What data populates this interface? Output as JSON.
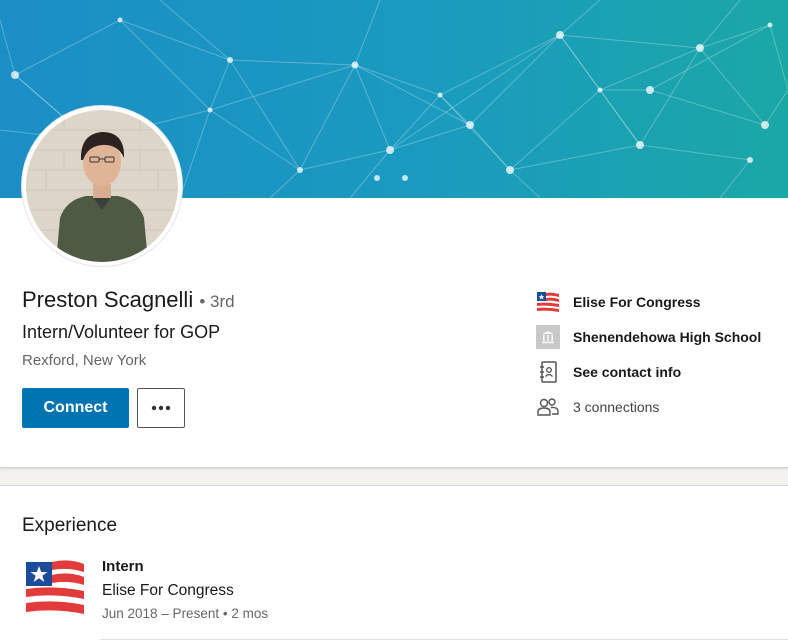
{
  "profile": {
    "name": "Preston Scagnelli",
    "degree": "• 3rd",
    "headline": "Intern/Volunteer for GOP",
    "location": "Rexford, New York"
  },
  "actions": {
    "connect_label": "Connect",
    "more_label": "···"
  },
  "sidebar": {
    "items": [
      {
        "label": "Elise For Congress",
        "icon": "flag-logo-icon"
      },
      {
        "label": "Shenendehowa High School",
        "icon": "school-icon"
      },
      {
        "label": "See contact info",
        "icon": "contact-book-icon"
      },
      {
        "label": "3 connections",
        "icon": "people-icon"
      }
    ]
  },
  "experience": {
    "section_title": "Experience",
    "items": [
      {
        "title": "Intern",
        "company": "Elise For Congress",
        "dates": "Jun 2018 – Present",
        "duration": "• 2 mos"
      }
    ]
  },
  "colors": {
    "primary": "#0073b1",
    "banner_left": "#1a8fc4",
    "banner_right": "#1aa3a6",
    "flag_red": "#e23b3b",
    "flag_blue": "#1b4b9b"
  }
}
